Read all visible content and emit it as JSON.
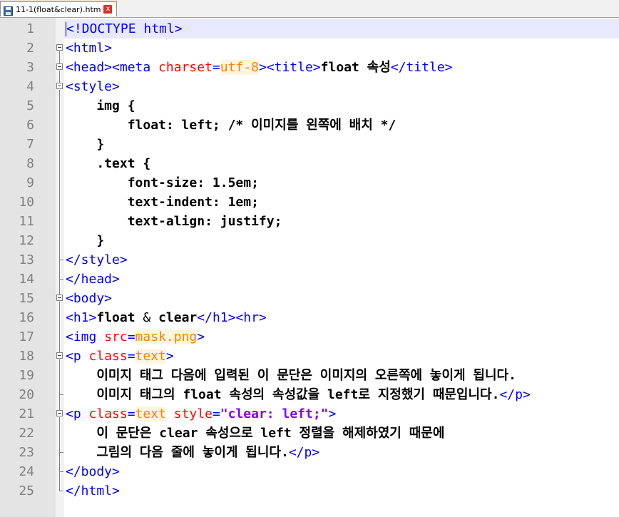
{
  "tab": {
    "filename": "11-1(float&clear).htm",
    "close": "x"
  },
  "lines": [
    {
      "n": "1",
      "text": "<!DOCTYPE html>"
    },
    {
      "n": "2",
      "text": "<html>"
    },
    {
      "n": "3",
      "text": "<head><meta charset=utf-8><title>float 속성</title>"
    },
    {
      "n": "4",
      "text": "<style>"
    },
    {
      "n": "5",
      "text": "    img {"
    },
    {
      "n": "6",
      "text": "        float: left; /* 이미지를 왼쪽에 배치 */"
    },
    {
      "n": "7",
      "text": "    }"
    },
    {
      "n": "8",
      "text": "    .text {"
    },
    {
      "n": "9",
      "text": "        font-size: 1.5em;"
    },
    {
      "n": "10",
      "text": "        text-indent: 1em;"
    },
    {
      "n": "11",
      "text": "        text-align: justify;"
    },
    {
      "n": "12",
      "text": "    }"
    },
    {
      "n": "13",
      "text": "</style>"
    },
    {
      "n": "14",
      "text": "</head>"
    },
    {
      "n": "15",
      "text": "<body>"
    },
    {
      "n": "16",
      "text": "<h1>float & clear</h1><hr>"
    },
    {
      "n": "17",
      "text": "<img src=mask.png>"
    },
    {
      "n": "18",
      "text": "<p class=text>"
    },
    {
      "n": "19",
      "text": "    이미지 태그 다음에 입력된 이 문단은 이미지의 오른쪽에 놓이게 됩니다."
    },
    {
      "n": "20",
      "text": "    이미지 태그의 float 속성의 속성값을 left로 지정했기 때문입니다.</p>"
    },
    {
      "n": "21",
      "text": "<p class=text style=\"clear: left;\">"
    },
    {
      "n": "22",
      "text": "    이 문단은 clear 속성으로 left 정렬을 해제하였기 때문에"
    },
    {
      "n": "23",
      "text": "    그림의 다음 줄에 놓이게 됩니다.</p>"
    },
    {
      "n": "24",
      "text": "</body>"
    },
    {
      "n": "25",
      "text": "</html>"
    }
  ]
}
